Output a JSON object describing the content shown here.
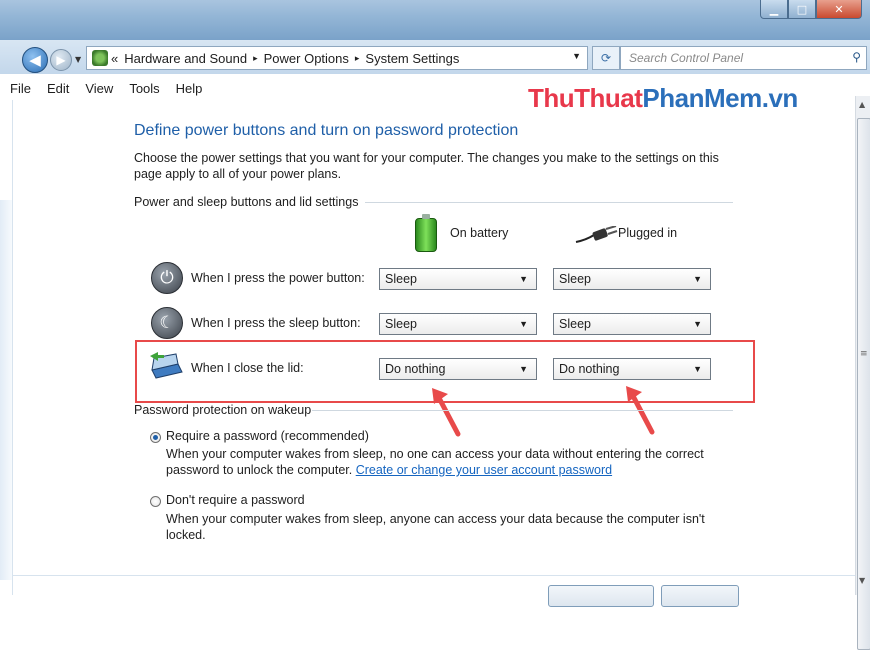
{
  "window": {
    "minimize_icon": "minimize-icon",
    "maximize_icon": "maximize-icon",
    "close_icon": "close-icon",
    "minimize_glyph": "▁",
    "maximize_glyph": "□",
    "close_glyph": "✕"
  },
  "address": {
    "breadcrumb_prefix": "«",
    "crumbs": [
      "Hardware and Sound",
      "Power Options",
      "System Settings"
    ],
    "separator": "▸",
    "search_placeholder": "Search Control Panel"
  },
  "menu": [
    "File",
    "Edit",
    "View",
    "Tools",
    "Help"
  ],
  "watermark": {
    "part1": "ThuThuat",
    "part2": "PhanMem.vn",
    "color1": "#e8384b",
    "color2": "#2b6fba"
  },
  "page": {
    "title": "Define power buttons and turn on password protection",
    "intro": "Choose the power settings that you want for your computer. The changes you make to the settings on this page apply to all of your power plans."
  },
  "power_section": {
    "heading": "Power and sleep buttons and lid settings",
    "col_battery": "On battery",
    "col_plugged": "Plugged in",
    "rows": [
      {
        "label": "When I press the power button:",
        "battery": "Sleep",
        "plugged": "Sleep",
        "icon": "power-button-icon"
      },
      {
        "label": "When I press the sleep button:",
        "battery": "Sleep",
        "plugged": "Sleep",
        "icon": "sleep-button-icon"
      },
      {
        "label": "When I close the lid:",
        "battery": "Do nothing",
        "plugged": "Do nothing",
        "icon": "laptop-lid-icon"
      }
    ]
  },
  "password_section": {
    "heading": "Password protection on wakeup",
    "options": [
      {
        "label": "Require a password (recommended)",
        "selected": true,
        "desc": "When your computer wakes from sleep, no one can access your data without entering the correct password to unlock the computer.",
        "link": "Create or change your user account password"
      },
      {
        "label": "Don't require a password",
        "selected": false,
        "desc": "When your computer wakes from sleep, anyone can access your data because the computer isn't locked."
      }
    ]
  },
  "colors": {
    "highlight": "#e84a4a",
    "title": "#1f5fa8",
    "link": "#1565c0"
  }
}
